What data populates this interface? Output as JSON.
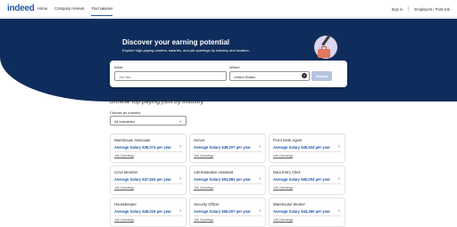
{
  "header": {
    "logo": "indeed",
    "nav": [
      "Home",
      "Company reviews",
      "Find salaries"
    ],
    "active_nav": 2,
    "sign_in": "Sign in",
    "employers": "Employers / Post Job"
  },
  "hero": {
    "title": "Discover your earning potential",
    "subtitle": "Explore high-paying careers, salaries, and job openings by industry and location."
  },
  "search": {
    "what_label": "What",
    "what_placeholder": "Job title",
    "where_label": "Where",
    "where_value": "United States",
    "button": "Search"
  },
  "browse": {
    "title": "Browse top paying jobs by industry",
    "choose_label": "Choose an industry",
    "selected": "All Industries"
  },
  "cards": [
    {
      "title": "Warehouse Associate",
      "salary": "Average Salary $36,074 per year",
      "link": "Job Openings"
    },
    {
      "title": "Server",
      "salary": "Average Salary $49,207 per year",
      "link": "Job Openings"
    },
    {
      "title": "Front Desk Agent",
      "salary": "Average Salary $45,534 per year",
      "link": "Job Openings"
    },
    {
      "title": "Crew Member",
      "salary": "Average Salary $47,834 per year",
      "link": "Job Openings"
    },
    {
      "title": "Administrative Assistant",
      "salary": "Average Salary $53,983 per year",
      "link": "Job Openings"
    },
    {
      "title": "Data Entry Clerk",
      "salary": "Average Salary $50,004 per year",
      "link": "Job Openings"
    },
    {
      "title": "Housekeeper",
      "salary": "Average Salary $45,018 per year",
      "link": "Job Openings"
    },
    {
      "title": "Security Officer",
      "salary": "Average Salary $60,007 per year",
      "link": "Job Openings"
    },
    {
      "title": "Warehouse Worker",
      "salary": "Average Salary $43,360 per year",
      "link": "Job Openings"
    }
  ],
  "colors": {
    "brand": "#2557a7",
    "hero_bg": "#0f2d5c"
  }
}
